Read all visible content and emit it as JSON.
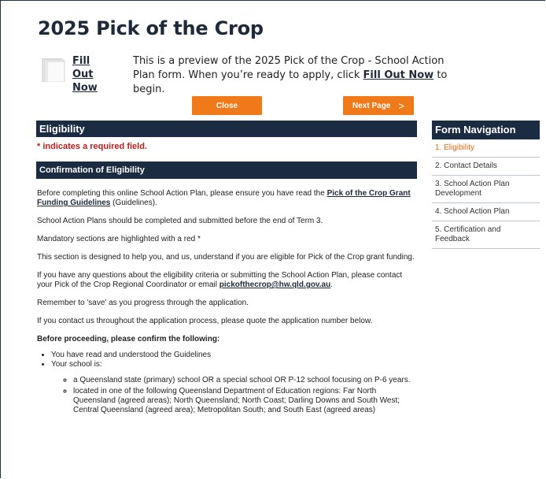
{
  "header": {
    "title": "2025 Pick of the Crop"
  },
  "preview": {
    "fill_out_line1": "Fill Out",
    "fill_out_line2": "Now",
    "text_before": "This is a preview of the 2025 Pick of the Crop - School Action Plan form. When you’re ready to apply, click ",
    "text_link": "Fill Out Now",
    "text_after": " to begin."
  },
  "buttons": {
    "close": "Close",
    "next_page": "Next Page",
    "next_arrow": ">"
  },
  "section": {
    "eligibility_title": "Eligibility",
    "required_note": "* indicates a required field.",
    "confirmation_title": "Confirmation of Eligibility"
  },
  "body": {
    "p1_before": "Before completing this online School Action Plan, please ensure you have read the ",
    "p1_link": "Pick of the Crop Grant Funding Guidelines",
    "p1_after": " (Guidelines).",
    "p2": "School Action Plans should be completed and submitted before the end of Term 3.",
    "p3": "Mandatory sections are highlighted with a red *",
    "p4": "This section is designed to help you, and us, understand if you are eligible for Pick of the Crop grant funding.",
    "p5_before": "If you have any questions about the eligibility criteria or submitting the School Action Plan, please contact your Pick of the Crop Regional Coordinator or email ",
    "p5_link": "pickofthecrop@hw.qld.gov.au",
    "p5_after": ".",
    "p6": "Remember to 'save' as you progress through the application.",
    "p7": "If you contact us throughout the application process, please quote the application number below.",
    "lead": "Before proceeding, please confirm the following:",
    "bullets": [
      "You have read and understood the Guidelines",
      "Your school is:"
    ],
    "sub_bullets": [
      "a Queensland state (primary) school OR a special school OR P-12 school focusing on P-6 years.",
      "located in one of the following Queensland Department of Education regions: Far North Queensland (agreed areas); North Queensland; North Coast; Darling Downs and South West; Central Queensland (agreed area); Metropolitan South; and South East (agreed areas)"
    ]
  },
  "nav": {
    "title": "Form Navigation",
    "items": [
      {
        "label": "1. Eligibility"
      },
      {
        "label": "2. Contact Details"
      },
      {
        "label": "3. School Action Plan Development"
      },
      {
        "label": "4. School Action Plan"
      },
      {
        "label": "5. Certification and Feedback"
      }
    ]
  },
  "colors": {
    "navy": "#1b2b41",
    "orange": "#f07a1a",
    "required_red": "#c41b1b",
    "active_nav": "#e86b10"
  },
  "icons": {
    "document": "document-icon"
  }
}
